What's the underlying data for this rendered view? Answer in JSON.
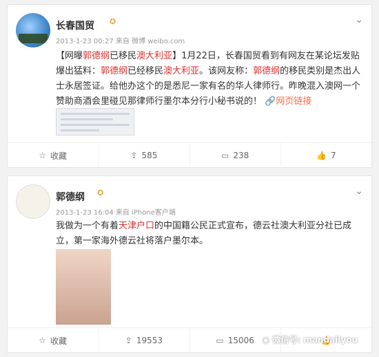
{
  "posts": [
    {
      "author": "长春国贸",
      "timestamp": "2013-1-23 00:27 来自 微博 weibo.com",
      "content": {
        "s1": "【网曝",
        "s2": "郭德纲",
        "s3": "已移民",
        "s4": "澳大利亚",
        "s5": "】1月22日，长春国贸看到有网友在某论坛发贴爆出猛料：",
        "s6": "郭德纲",
        "s7": "已经移民",
        "s8": "澳大利亚",
        "s9": "。该网友称：",
        "s10": "郭德纲",
        "s11": "的移民类别是杰出人士永居签证。给他办这个的是悉尼一家有名的华人律师行。昨晚混入澳网一个赞助商酒会里碰见那律师行墨尔本分行小秘书说的！",
        "link": "网页链接"
      },
      "actions": {
        "favorite": "收藏",
        "repost": "585",
        "comment": "238",
        "like": "7"
      }
    },
    {
      "author": "郭德纲",
      "timestamp": "2013-1-23 16:04 来自 iPhone客户端",
      "content": {
        "p1": "我做为一个有着",
        "p2": "天津户口",
        "p3": "的中国籍公民正式宣布，德云社澳大利亚分社已成立，第一家海外德云社将落户墨尔本。"
      },
      "actions": {
        "favorite": "收藏",
        "repost": "19553",
        "comment": "15006"
      }
    }
  ],
  "watermark": "微信号: mandailyou",
  "colors": {
    "highlight": "#e0312e",
    "link": "#ff6a4c",
    "verified_badge": "#e8a22c"
  },
  "icons": [
    "caret-down-icon",
    "star-icon",
    "repost-icon",
    "comment-icon",
    "thumb-up-icon",
    "wechat-icon",
    "verified-badge-icon"
  ]
}
